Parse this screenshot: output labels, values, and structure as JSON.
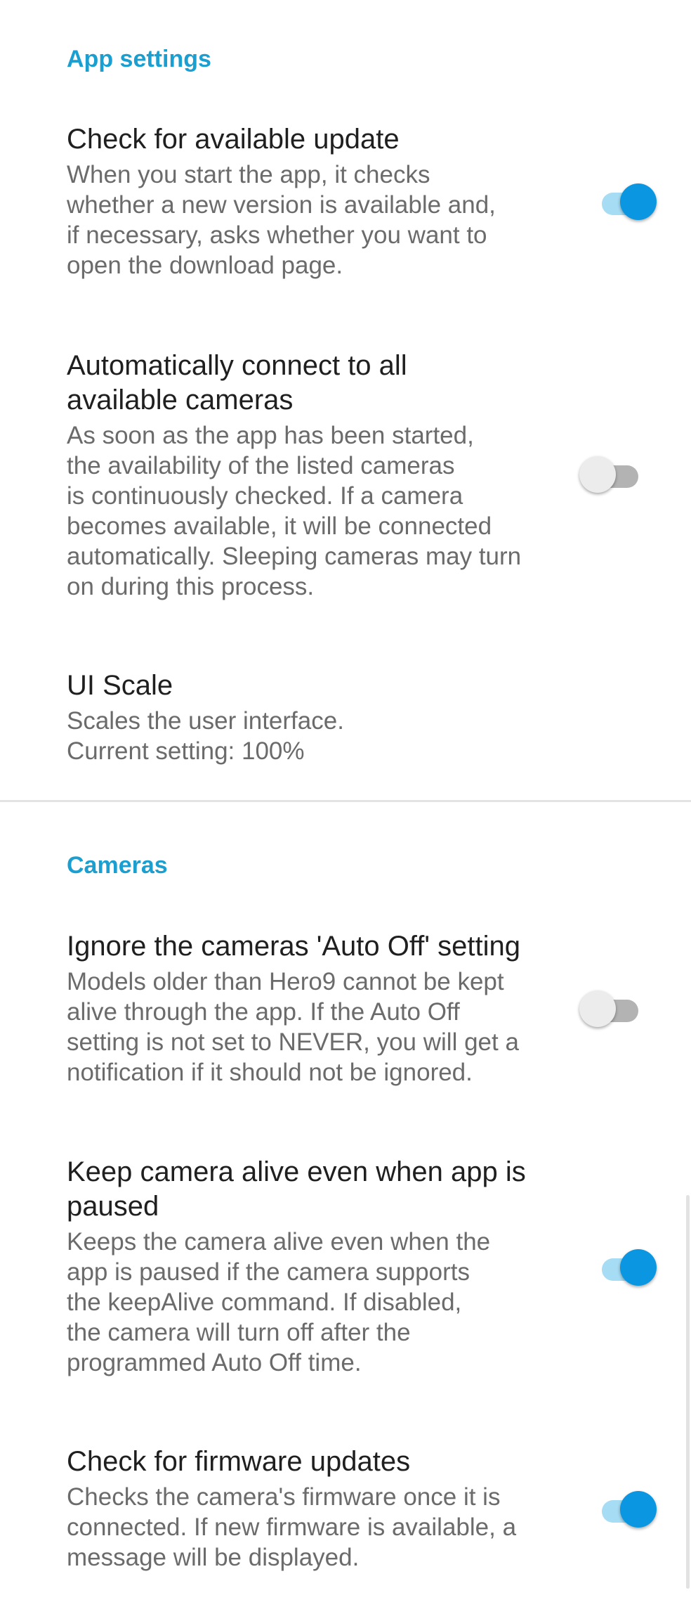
{
  "app_settings": {
    "header": "App settings",
    "check_update": {
      "title": "Check for available update",
      "summary": "When you start the app, it checks\nwhether a new version is available and,\nif necessary, asks whether you want to\nopen the download page.",
      "enabled": true
    },
    "auto_connect": {
      "title": "Automatically connect to all\navailable cameras",
      "summary": "As soon as the app has been started,\nthe availability of the listed cameras\nis continuously checked. If a camera\nbecomes available, it will be connected\nautomatically. Sleeping cameras may turn\non during this process.",
      "enabled": false
    },
    "ui_scale": {
      "title": "UI Scale",
      "summary": "Scales the user interface.\nCurrent setting: 100%"
    }
  },
  "cameras": {
    "header": "Cameras",
    "ignore_auto_off": {
      "title": "Ignore the cameras 'Auto Off' setting",
      "summary": "Models older than Hero9 cannot be kept\nalive through the app. If the Auto Off\nsetting is not set to NEVER, you will get a\nnotification if it should not be ignored.",
      "enabled": false
    },
    "keep_alive": {
      "title": "Keep camera alive even when app is\npaused",
      "summary": "Keeps the camera alive even when the\napp is paused if the camera supports\nthe keepAlive command. If disabled,\nthe camera will turn off after the\nprogrammed Auto Off time.",
      "enabled": true
    },
    "firmware_updates": {
      "title": "Check for firmware updates",
      "summary": "Checks the camera's firmware once it is\nconnected. If new firmware is available, a\nmessage will be displayed.",
      "enabled": true
    }
  },
  "colors": {
    "accent": "#1a9fd0",
    "switch_on_thumb": "#0a96e0",
    "switch_on_track": "#a6dcf4",
    "switch_off_thumb": "#ececec",
    "switch_off_track": "#b3b3b3"
  }
}
